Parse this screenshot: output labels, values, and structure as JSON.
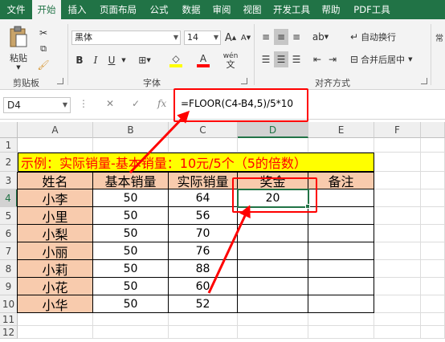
{
  "ribbon_tabs": [
    {
      "label": "文件"
    },
    {
      "label": "开始"
    },
    {
      "label": "插入"
    },
    {
      "label": "页面布局"
    },
    {
      "label": "公式"
    },
    {
      "label": "数据"
    },
    {
      "label": "审阅"
    },
    {
      "label": "视图"
    },
    {
      "label": "开发工具"
    },
    {
      "label": "帮助"
    },
    {
      "label": "PDF工具"
    }
  ],
  "active_tab": "开始",
  "clipboard": {
    "paste_label": "粘贴",
    "group_label": "剪贴板"
  },
  "font": {
    "name": "黑体",
    "size": "14",
    "group_label": "字体",
    "bold": "B",
    "italic": "I",
    "underline": "U",
    "grow": "A",
    "shrink": "A",
    "color_letter": "A",
    "phonetic": "wén"
  },
  "alignment": {
    "wrap_label": "自动换行",
    "merge_label": "合并后居中",
    "group_label": "对齐方式"
  },
  "formula_bar": {
    "name_box": "D4",
    "fx": "fx",
    "formula": "=FLOOR(C4-B4,5)/5*10"
  },
  "columns": [
    "A",
    "B",
    "C",
    "D",
    "E",
    "F"
  ],
  "rows": [
    "1",
    "2",
    "3",
    "4",
    "5",
    "6",
    "7",
    "8",
    "9",
    "10",
    "11",
    "12"
  ],
  "sheet": {
    "banner": "示例：实际销量-基本销量：10元/5个（5的倍数）",
    "headers": [
      "姓名",
      "基本销量",
      "实际销量",
      "奖金",
      "备注"
    ],
    "data_rows": [
      {
        "name": "小李",
        "base": "50",
        "actual": "64",
        "bonus": "20",
        "note": ""
      },
      {
        "name": "小里",
        "base": "50",
        "actual": "56",
        "bonus": "",
        "note": ""
      },
      {
        "name": "小梨",
        "base": "50",
        "actual": "70",
        "bonus": "",
        "note": ""
      },
      {
        "name": "小丽",
        "base": "50",
        "actual": "76",
        "bonus": "",
        "note": ""
      },
      {
        "name": "小莉",
        "base": "50",
        "actual": "88",
        "bonus": "",
        "note": ""
      },
      {
        "name": "小花",
        "base": "50",
        "actual": "60",
        "bonus": "",
        "note": ""
      },
      {
        "name": "小华",
        "base": "50",
        "actual": "52",
        "bonus": "",
        "note": ""
      }
    ]
  },
  "active_cell": "D4",
  "colors": {
    "excel_green": "#217346",
    "header_fill": "#f8cbad",
    "banner_fill": "#ffff00",
    "banner_text": "#ff0000",
    "annotation": "#ff0000"
  }
}
